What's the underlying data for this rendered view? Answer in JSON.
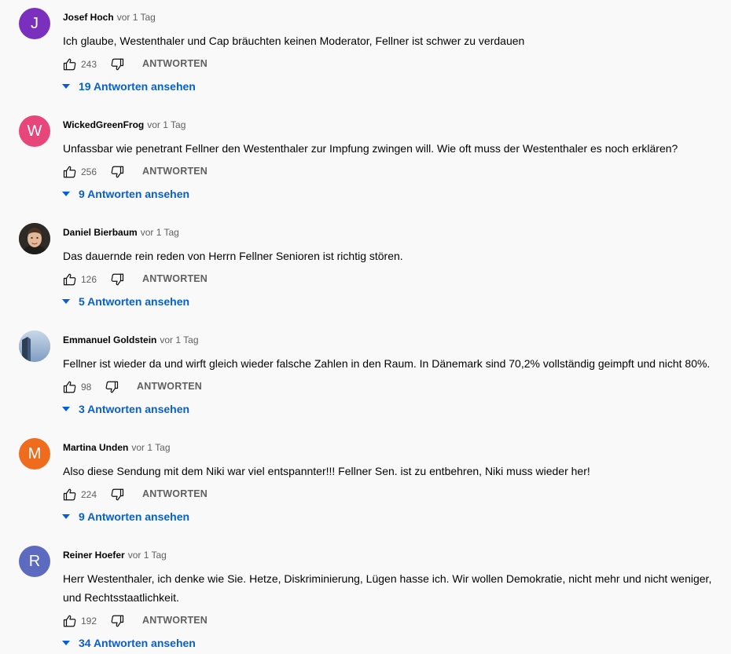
{
  "comments": [
    {
      "author": "Josef Hoch",
      "time": "vor 1 Tag",
      "avatar": {
        "letter": "J",
        "color": "#7b2fbe"
      },
      "text": "Ich glaube, Westenthaler und Cap bräuchten keinen Moderator,  Fellner ist schwer zu verdauen",
      "likes": "243",
      "reply_label": "ANTWORTEN",
      "replies_label": "19 Antworten ansehen"
    },
    {
      "author": "WickedGreenFrog",
      "time": "vor 1 Tag",
      "avatar": {
        "letter": "W",
        "color": "#e8457b"
      },
      "text": "Unfassbar wie penetrant Fellner den Westenthaler zur Impfung zwingen will. Wie oft muss der Westenthaler es noch erklären?",
      "likes": "256",
      "reply_label": "ANTWORTEN",
      "replies_label": "9 Antworten ansehen"
    },
    {
      "author": "Daniel Bierbaum",
      "time": "vor 1 Tag",
      "avatar": {
        "letter": "",
        "color": "#3d3a35"
      },
      "text": "Das dauernde rein reden von Herrn Fellner Senioren ist richtig stören.",
      "likes": "126",
      "reply_label": "ANTWORTEN",
      "replies_label": "5 Antworten ansehen"
    },
    {
      "author": "Emmanuel Goldstein",
      "time": "vor 1 Tag",
      "avatar": {
        "letter": "",
        "color": "#8aa4c4"
      },
      "text": "Fellner ist wieder da und wirft gleich wieder falsche Zahlen in den Raum. In Dänemark sind 70,2% vollständig geimpft und nicht 80%.",
      "likes": "98",
      "reply_label": "ANTWORTEN",
      "replies_label": "3 Antworten ansehen"
    },
    {
      "author": "Martina Unden",
      "time": "vor 1 Tag",
      "avatar": {
        "letter": "M",
        "color": "#ef6c1f"
      },
      "text": "Also diese Sendung mit dem Niki war viel entspannter!!! Fellner Sen. ist zu entbehren, Niki muss wieder her!",
      "likes": "224",
      "reply_label": "ANTWORTEN",
      "replies_label": "9 Antworten ansehen"
    },
    {
      "author": "Reiner Hoefer",
      "time": "vor 1 Tag",
      "avatar": {
        "letter": "R",
        "color": "#5c6bc0"
      },
      "text": "Herr Westenthaler, ich denke wie Sie. Hetze, Diskriminierung, Lügen hasse ich. Wir wollen Demokratie, nicht mehr und nicht weniger, und Rechtsstaatlichkeit.",
      "likes": "192",
      "reply_label": "ANTWORTEN",
      "replies_label": "34 Antworten ansehen"
    }
  ]
}
